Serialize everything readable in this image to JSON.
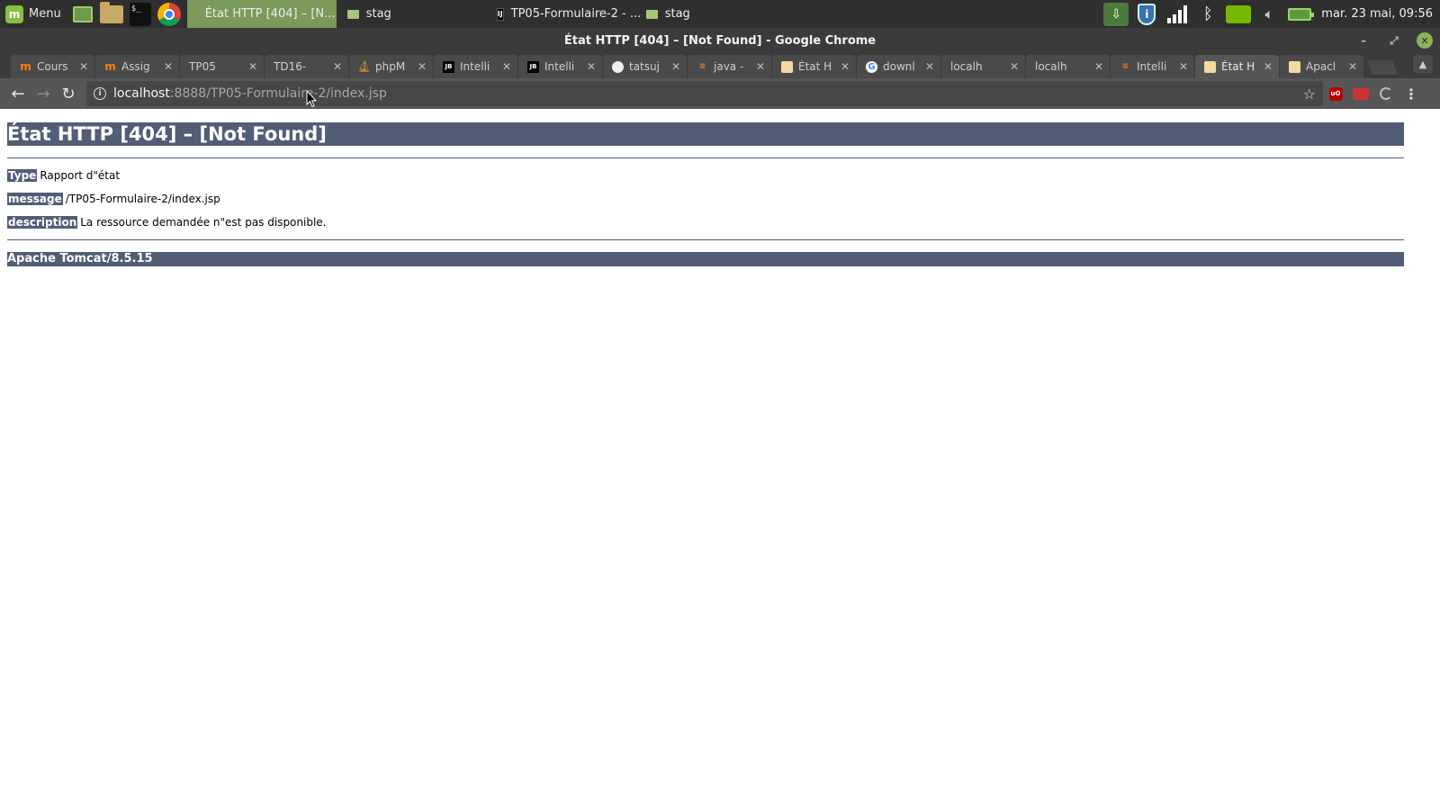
{
  "taskbar": {
    "menu_label": "Menu",
    "windows": [
      {
        "label": "État HTTP [404] – [N...",
        "icon": "chrome-icon",
        "active": true
      },
      {
        "label": "stag",
        "icon": "folder-icon",
        "active": false
      },
      {
        "label": "TP05-Formulaire-2 - ...",
        "icon": "intellij-icon",
        "active": false
      },
      {
        "label": "stag",
        "icon": "folder-icon",
        "active": false
      }
    ],
    "clock": "mar. 23 mai, 09:56"
  },
  "window": {
    "title": "État HTTP [404] – [Not Found] - Google Chrome"
  },
  "tabs": [
    {
      "label": "Cours",
      "icon": "moodle-icon"
    },
    {
      "label": "Assig",
      "icon": "moodle-icon"
    },
    {
      "label": "TP05",
      "icon": "page-icon"
    },
    {
      "label": "TD16-",
      "icon": "page-icon"
    },
    {
      "label": "phpM",
      "icon": "phpmyadmin-icon"
    },
    {
      "label": "Intelli",
      "icon": "jetbrains-icon"
    },
    {
      "label": "Intelli",
      "icon": "jetbrains-icon"
    },
    {
      "label": "tatsuj",
      "icon": "github-icon"
    },
    {
      "label": "java -",
      "icon": "stackoverflow-icon"
    },
    {
      "label": "État H",
      "icon": "tomcat-icon"
    },
    {
      "label": "downl",
      "icon": "google-icon"
    },
    {
      "label": "localh",
      "icon": "page-icon"
    },
    {
      "label": "localh",
      "icon": "page-icon"
    },
    {
      "label": "Intelli",
      "icon": "stackoverflow-icon"
    },
    {
      "label": "État H",
      "icon": "tomcat-icon",
      "active": true
    },
    {
      "label": "Apacl",
      "icon": "tomcat-icon"
    }
  ],
  "omnibox": {
    "host": "localhost",
    "rest": ":8888/TP05-Formulaire-2/index.jsp"
  },
  "page": {
    "heading": "État HTTP [404] – [Not Found]",
    "rows": [
      {
        "label": "Type",
        "value": "Rapport d\"état"
      },
      {
        "label": "message",
        "value": "/TP05-Formulaire-2/index.jsp"
      },
      {
        "label": "description",
        "value": "La ressource demandée n\"est pas disponible."
      }
    ],
    "footer": "Apache Tomcat/8.5.15"
  },
  "colors": {
    "tomcat_header": "#525d76",
    "taskbar": "#2f2f2f",
    "active_window": "#7a9a5a"
  }
}
